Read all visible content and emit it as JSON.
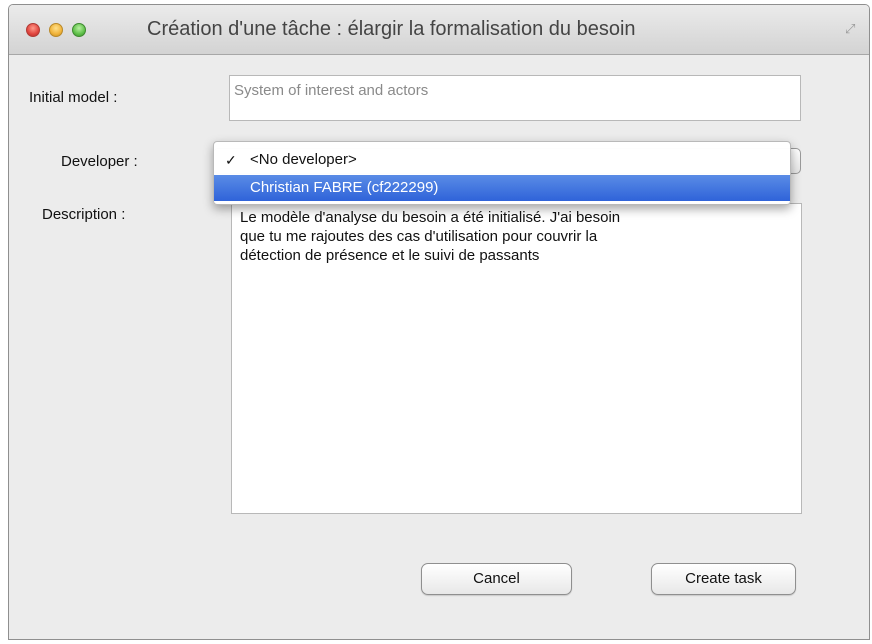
{
  "window": {
    "title": "Création d'une tâche : élargir la formalisation du besoin"
  },
  "form": {
    "initial_model_label": "Initial model :",
    "initial_model_placeholder": "System of interest and actors",
    "developer_label": "Developer :",
    "description_label": "Description :",
    "description_value": "Le modèle d'analyse du besoin a été initialisé. J'ai besoin\nque tu me rajoutes des  cas d'utilisation pour couvrir la\ndétection de présence et le suivi de passants"
  },
  "developer_menu": {
    "items": [
      {
        "label": "<No developer>",
        "checked": true,
        "highlighted": false
      },
      {
        "label": "Christian FABRE (cf222299)",
        "checked": false,
        "highlighted": true
      }
    ],
    "check_glyph": "✓"
  },
  "buttons": {
    "cancel": "Cancel",
    "create": "Create task"
  }
}
